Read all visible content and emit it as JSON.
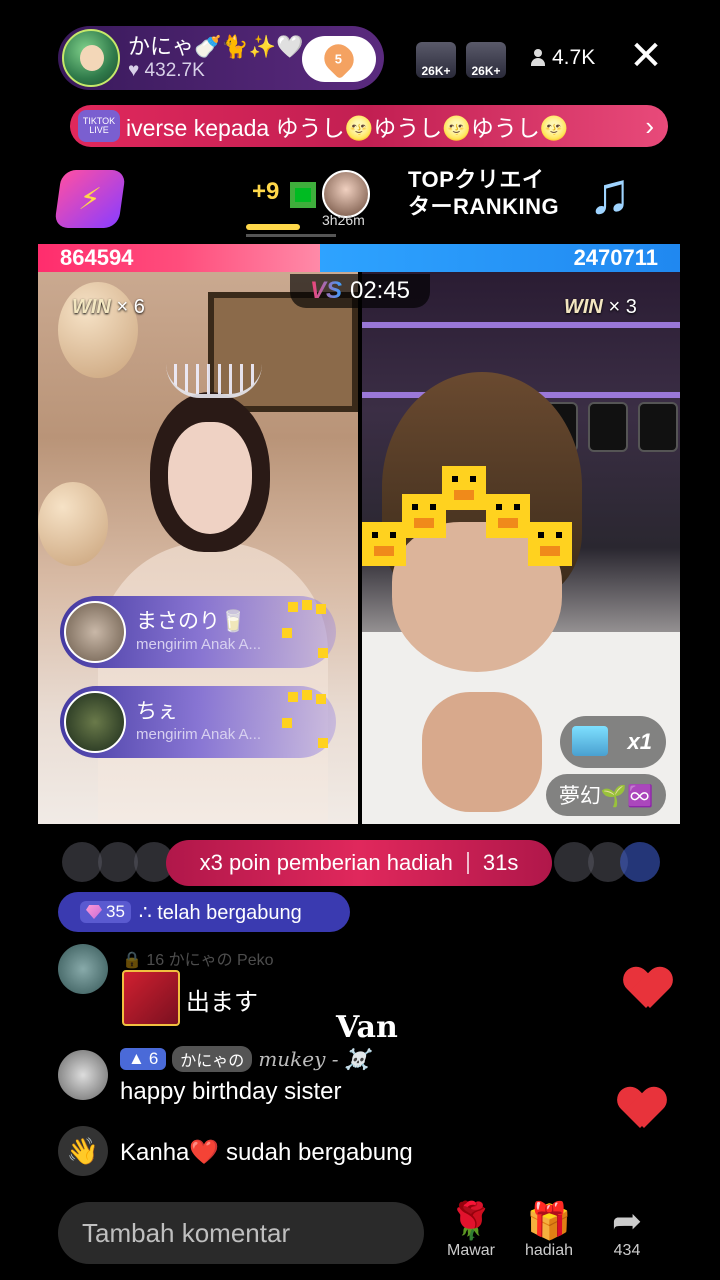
{
  "header": {
    "host_name": "かにゃ🍼🐈✨🤍",
    "host_likes": "♥ 432.7K",
    "follow_count": "5",
    "rank_badges": [
      "26K+",
      "26K+"
    ],
    "viewers": "4.7K",
    "close_label": "✕"
  },
  "banner": {
    "icon_label": "TIKTOK LIVE",
    "text": "iverse kepada ゆうし🌝ゆうし🌝ゆうし🌝",
    "chevron": "›"
  },
  "event": {
    "plus_count": "+9",
    "timer": "3h26m",
    "ranking_line1": "TOPクリエイ",
    "ranking_line2": "ターRANKING"
  },
  "battle": {
    "score_left": "864594",
    "score_right": "2470711",
    "vs": "VS",
    "timer": "02:45",
    "left_win": "WIN",
    "left_win_count": "× 6",
    "right_win": "WIN",
    "right_win_count": "× 3",
    "right_gift_count": "x1",
    "right_name": "夢幻🌱♾️",
    "gifts": [
      {
        "name": "まさのり🥛",
        "sub": "mengirim Anak A..."
      },
      {
        "name": "ちぇ",
        "sub": "mengirim Anak A..."
      }
    ]
  },
  "points": {
    "text": "x3 poin pemberian hadiah",
    "countdown": "31s"
  },
  "joined": {
    "gem_count": "35",
    "text": "∴ telah bergabung"
  },
  "comments": [
    {
      "faded": "🔒 16  かにゃの  Peko",
      "text": "出ます"
    },
    {
      "level": "6",
      "fan_badge": "かにゃの",
      "username": "mukey - ☠️",
      "text": "happy birthday sister"
    },
    {
      "text": "Kanha❤️ sudah bergabung"
    }
  ],
  "overlay": "Van",
  "bottom": {
    "placeholder": "Tambah komentar",
    "rose_label": "Mawar",
    "gift_label": "hadiah",
    "share_count": "434"
  },
  "colors": {
    "left_team": "#ff2d6d",
    "right_team": "#2ea3ff",
    "points_pill": "#e0285c",
    "heart": "#e8333b"
  }
}
